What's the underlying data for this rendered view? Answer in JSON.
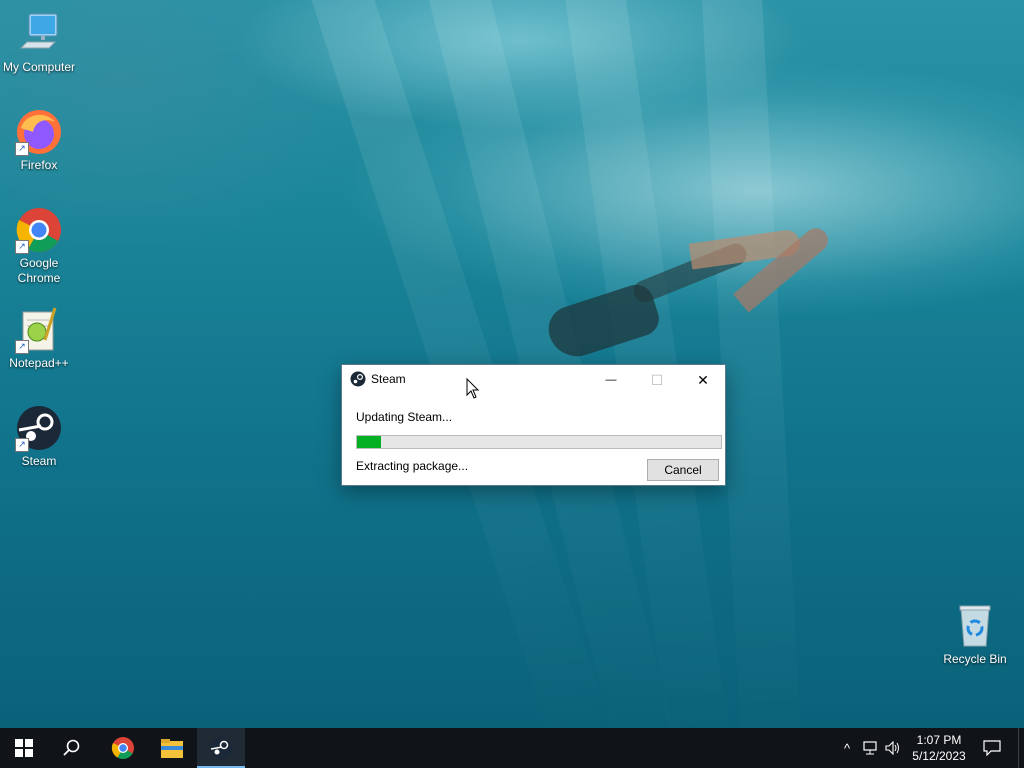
{
  "desktop": {
    "icons": [
      {
        "label": "My Computer"
      },
      {
        "label": "Firefox"
      },
      {
        "label": "Google Chrome"
      },
      {
        "label": "Notepad++"
      },
      {
        "label": "Steam"
      },
      {
        "label": "Recycle Bin"
      }
    ]
  },
  "dialog": {
    "title": "Steam",
    "status": "Updating Steam...",
    "substatus": "Extracting package...",
    "progress": 0.065,
    "cancel_label": "Cancel",
    "minimize_glyph": "—",
    "maximize_glyph": "☐",
    "close_glyph": "✕"
  },
  "taskbar": {
    "items": [
      "start-icon",
      "search-icon",
      "chrome-icon",
      "file-explorer-icon",
      "steam-icon"
    ],
    "active": "steam-icon",
    "tray": {
      "chevron": "^",
      "time": "1:07 PM",
      "date": "5/12/2023"
    }
  },
  "colors": {
    "progress_fill": "#06b025",
    "taskbar": "#101418",
    "accent": "#76b9ed"
  }
}
